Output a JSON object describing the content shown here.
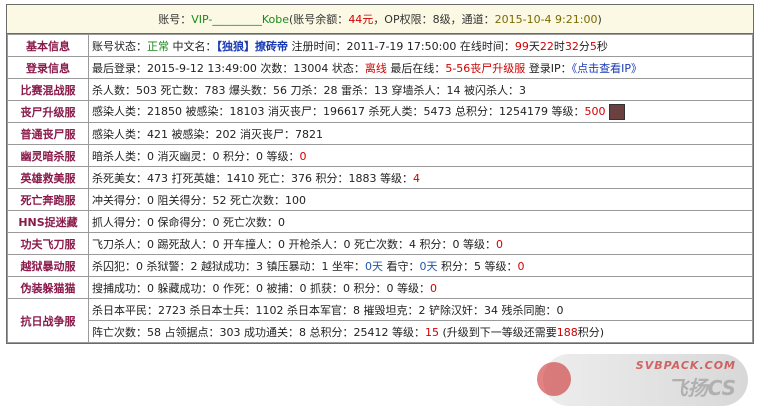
{
  "account": {
    "label1": "账号：",
    "id": "VIP-_________Kobe",
    "label2": "(账号余额：",
    "balance": "44元",
    "label3": "，OP权限：",
    "op": "8级",
    "label4": "，通道：",
    "channel": "2015-10-4 9:21:00",
    "label5": ")"
  },
  "rows": [
    {
      "head": "基本信息",
      "text": {
        "t1": "账号状态：",
        "status": "正常",
        "t2": " 中文名：",
        "name": "【独狼】撩砖帝",
        "t3": " 注册时间：2011-7-19 17:50:00 在线时间：",
        "d": "99",
        "t4": "天",
        "h": "22",
        "t5": "时",
        "m": "32",
        "t6": "分",
        "s": "5",
        "t7": "秒"
      }
    },
    {
      "head": "登录信息",
      "text": {
        "t1": "最后登录：2015-9-12 13:49:00 次数：13004 状态：",
        "status": "离线",
        "t2": " 最后在线：",
        "server": "5-56丧尸升级服",
        "t3": " 登录IP：",
        "ip": "《点击查看IP》"
      }
    },
    {
      "head": "比赛混战服",
      "line": "杀人数：503 死亡数：783 爆头数：56 刀杀：28 雷杀：13 穿墙杀人：14 被闪杀人：3"
    },
    {
      "head": "丧尸升级服",
      "text": {
        "t1": "感染人类：21850 被感染：18103 消灭丧尸：196617 杀死人类：5473 总积分：1254179 等级：",
        "lv": "500"
      }
    },
    {
      "head": "普通丧尸服",
      "line": "感染人类：421 被感染：202 消灭丧尸：7821"
    },
    {
      "head": "幽灵暗杀服",
      "text": {
        "t1": "暗杀人类：0 消灭幽灵：0 积分：0 等级：",
        "lv": "0"
      }
    },
    {
      "head": "英雄救美服",
      "text": {
        "t1": "杀死美女：473 打死英雄：1410 死亡：376 积分：1883 等级：",
        "lv": "4"
      }
    },
    {
      "head": "死亡奔跑服",
      "line": "冲关得分：0 阻关得分：52 死亡次数：100"
    },
    {
      "head": "HNS捉迷藏",
      "line": "抓人得分：0 保命得分：0 死亡次数：0"
    },
    {
      "head": "功夫飞刀服",
      "text": {
        "t1": "飞刀杀人：0 踢死敌人：0 开车撞人：0 开枪杀人：0 死亡次数：4 积分：0 等级：",
        "lv": "0"
      }
    },
    {
      "head": "越狱暴动服",
      "text": {
        "t1": "杀囚犯：0 杀狱警：2 越狱成功：3 镇压暴动：1 坐牢：",
        "a": "0天",
        "t2": " 看守：",
        "b": "0天",
        "t3": " 积分：5 等级：",
        "lv": "0"
      }
    },
    {
      "head": "伪装躲猫猫",
      "text": {
        "t1": "搜捕成功：0 躲藏成功：0 作死：0 被捕：0 抓获：0 积分：0 等级：",
        "lv": "0"
      }
    },
    {
      "head": "抗日战争服",
      "line1": "杀日本平民：2723 杀日本士兵：1102 杀日本军官：8 摧毁坦克：2 铲除汉奸：34 残杀同胞：0",
      "text": {
        "t1": "阵亡次数：58 占领据点：303 成功通关：8 总积分：25412 等级：",
        "lv": "15",
        "t2": " (升级到下一等级还需要",
        "need": "188",
        "t3": "积分)"
      }
    }
  ],
  "watermark": {
    "line1": "SVBPACK.COM",
    "line2": "飞扬CS"
  }
}
